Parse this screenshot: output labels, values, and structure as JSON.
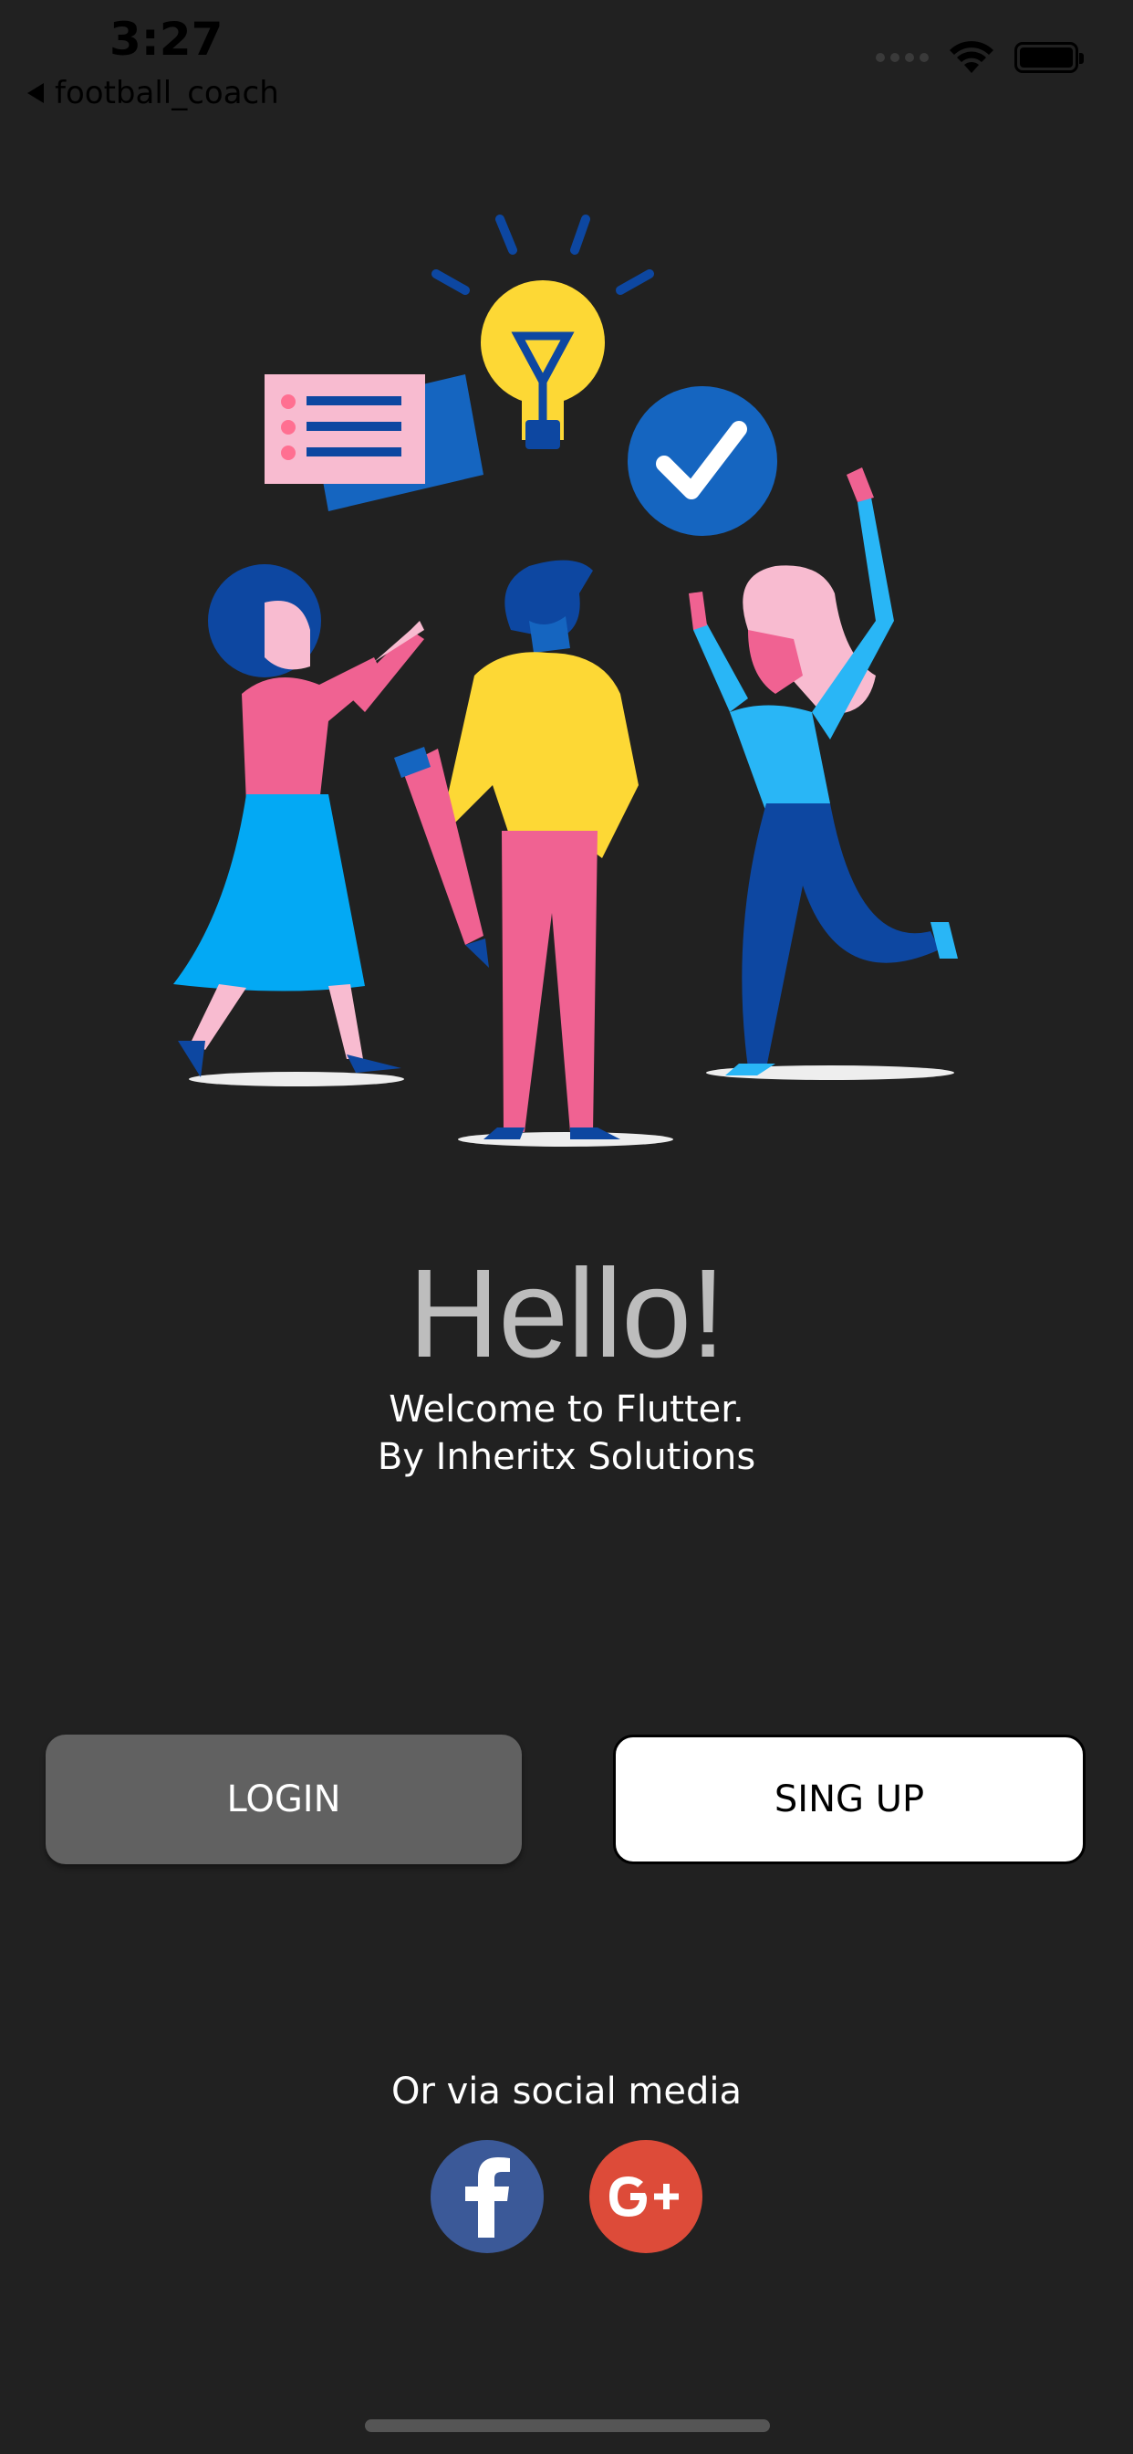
{
  "status_bar": {
    "time": "3:27",
    "back_app": "football_coach"
  },
  "main": {
    "title": "Hello!",
    "subtitle_line1": "Welcome to Flutter.",
    "subtitle_line2": "By Inheritx Solutions"
  },
  "buttons": {
    "login": "LOGIN",
    "signup": "SING UP"
  },
  "social": {
    "label": "Or via social media",
    "facebook_icon": "facebook-icon",
    "google_icon": "google-plus-icon"
  },
  "colors": {
    "background": "#212121",
    "login_button": "#616161",
    "signup_button": "#ffffff",
    "facebook": "#3b5998",
    "google_plus": "#dd4b39"
  }
}
